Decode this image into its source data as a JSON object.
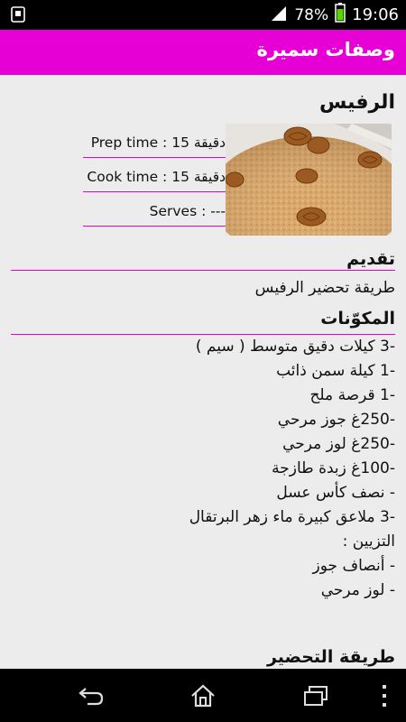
{
  "status_bar": {
    "battery_percent": "78%",
    "time": "19:06",
    "icons": [
      "notification-icon",
      "signal-icon",
      "battery-icon"
    ]
  },
  "app_bar": {
    "title": "وصفات سميرة"
  },
  "recipe": {
    "title": "الرفيس",
    "prep_time": "Prep time : 15 دقيقة",
    "cook_time": "Cook time : 15 دقيقة",
    "serves": "Serves : ---"
  },
  "intro": {
    "heading": "تقديم",
    "text": "طريقة تحضير الرفيس"
  },
  "ingredients": {
    "heading": "المكوّنات",
    "items": [
      "-3 كيلات دقيق متوسط ( سيم )",
      "-1 كيلة سمن ذائب",
      "-1 قرصة ملح",
      "-250غ جوز مرحي",
      "-250غ لوز مرحي",
      "-100غ زبدة طازجة",
      "- نصف كأس عسل",
      "-3 ملاعق كبيرة ماء زهر البرتقال",
      "التزيين :",
      "- أنصاف جوز",
      "- لوز مرحي"
    ]
  },
  "preparation": {
    "heading": "طريقة التحضير"
  },
  "colors": {
    "accent": "#e600d6",
    "background": "#ececec"
  }
}
